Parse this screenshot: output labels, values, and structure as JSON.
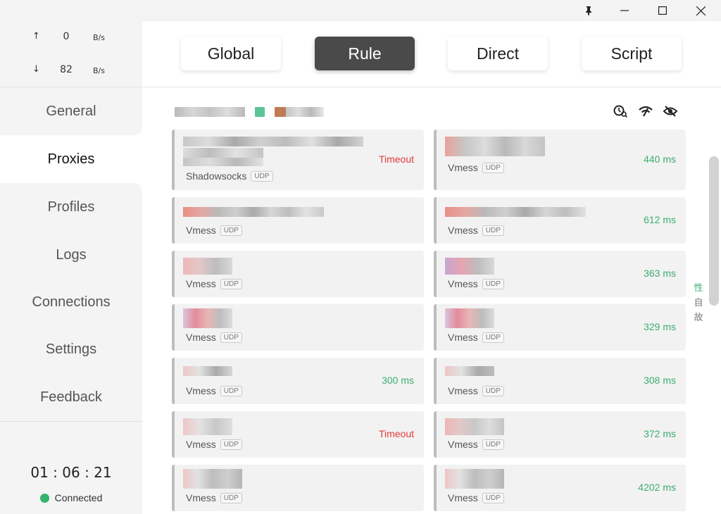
{
  "titlebar": {
    "pin_icon": "pin-icon",
    "minimize_icon": "minimize-icon",
    "maximize_icon": "maximize-icon",
    "close_icon": "close-icon"
  },
  "traffic": {
    "up_arrow": "↑",
    "up_value": "0",
    "up_unit": "B/s",
    "down_arrow": "↓",
    "down_value": "82",
    "down_unit": "B/s"
  },
  "nav": {
    "items": [
      {
        "label": "General"
      },
      {
        "label": "Proxies"
      },
      {
        "label": "Profiles"
      },
      {
        "label": "Logs"
      },
      {
        "label": "Connections"
      },
      {
        "label": "Settings"
      },
      {
        "label": "Feedback"
      }
    ],
    "active": "Proxies"
  },
  "session": {
    "timer": "01 : 06 : 21",
    "status": "Connected",
    "status_color": "#33b36b"
  },
  "modes": {
    "global": "Global",
    "rule": "Rule",
    "direct": "Direct",
    "script": "Script",
    "active": "Rule"
  },
  "toolbar_icons": [
    "latency-test-icon",
    "wifi-speed-icon",
    "hide-eye-icon"
  ],
  "proxies": {
    "left": [
      {
        "type": "Shadowsocks",
        "tag": "UDP",
        "latency": "Timeout",
        "status": "timeout"
      },
      {
        "type": "Vmess",
        "tag": "UDP",
        "latency": "",
        "status": "ok"
      },
      {
        "type": "Vmess",
        "tag": "UDP",
        "latency": "",
        "status": "timeout"
      },
      {
        "type": "Vmess",
        "tag": "UDP",
        "latency": "",
        "status": "ok"
      },
      {
        "type": "Vmess",
        "tag": "UDP",
        "latency": "300 ms",
        "status": "ok"
      },
      {
        "type": "Vmess",
        "tag": "UDP",
        "latency": "Timeout",
        "status": "timeout"
      },
      {
        "type": "Vmess",
        "tag": "UDP",
        "latency": "",
        "status": "ok"
      }
    ],
    "right": [
      {
        "type": "Vmess",
        "tag": "UDP",
        "latency": "440 ms",
        "status": "ok"
      },
      {
        "type": "Vmess",
        "tag": "UDP",
        "latency": "612 ms",
        "status": "ok"
      },
      {
        "type": "Vmess",
        "tag": "UDP",
        "latency": "363 ms",
        "status": "ok"
      },
      {
        "type": "Vmess",
        "tag": "UDP",
        "latency": "329 ms",
        "status": "ok"
      },
      {
        "type": "Vmess",
        "tag": "UDP",
        "latency": "308 ms",
        "status": "ok"
      },
      {
        "type": "Vmess",
        "tag": "UDP",
        "latency": "372 ms",
        "status": "ok"
      },
      {
        "type": "Vmess",
        "tag": "UDP",
        "latency": "4202 ms",
        "status": "ok"
      }
    ]
  },
  "side_letters": [
    {
      "char": "性",
      "color": "#3aae6f"
    },
    {
      "char": "自",
      "color": "#777777"
    },
    {
      "char": "故",
      "color": "#777777"
    }
  ],
  "colors": {
    "ok": "#3aae6f",
    "timeout": "#e23a3a",
    "active_mode": "#4a4a4a"
  }
}
